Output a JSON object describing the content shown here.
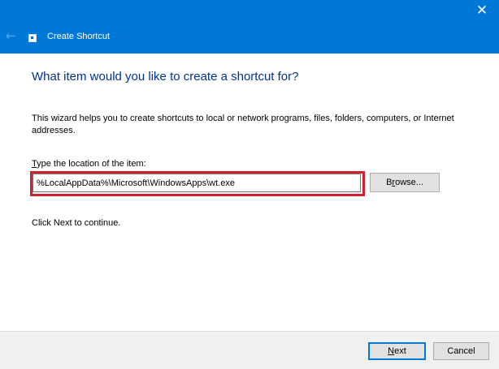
{
  "window": {
    "title": "Create Shortcut",
    "close_glyph": "✕",
    "back_glyph": "←",
    "title_bar_color": "#0078d7"
  },
  "wizard": {
    "heading": "What item would you like to create a shortcut for?",
    "description": "This wizard helps you to create shortcuts to local or network programs, files, folders, computers, or Internet addresses.",
    "location_label": "Type the location of the item:",
    "location_value": "%LocalAppData%\\Microsoft\\WindowsApps\\wt.exe",
    "browse_label": "Browse...",
    "continue_text": "Click Next to continue.",
    "highlight_color": "#d0202d"
  },
  "buttons": {
    "next_label": "Next",
    "cancel_label": "Cancel"
  },
  "icons": {
    "back": "back-arrow-icon",
    "close": "close-icon",
    "app": "shortcut-app-icon"
  }
}
